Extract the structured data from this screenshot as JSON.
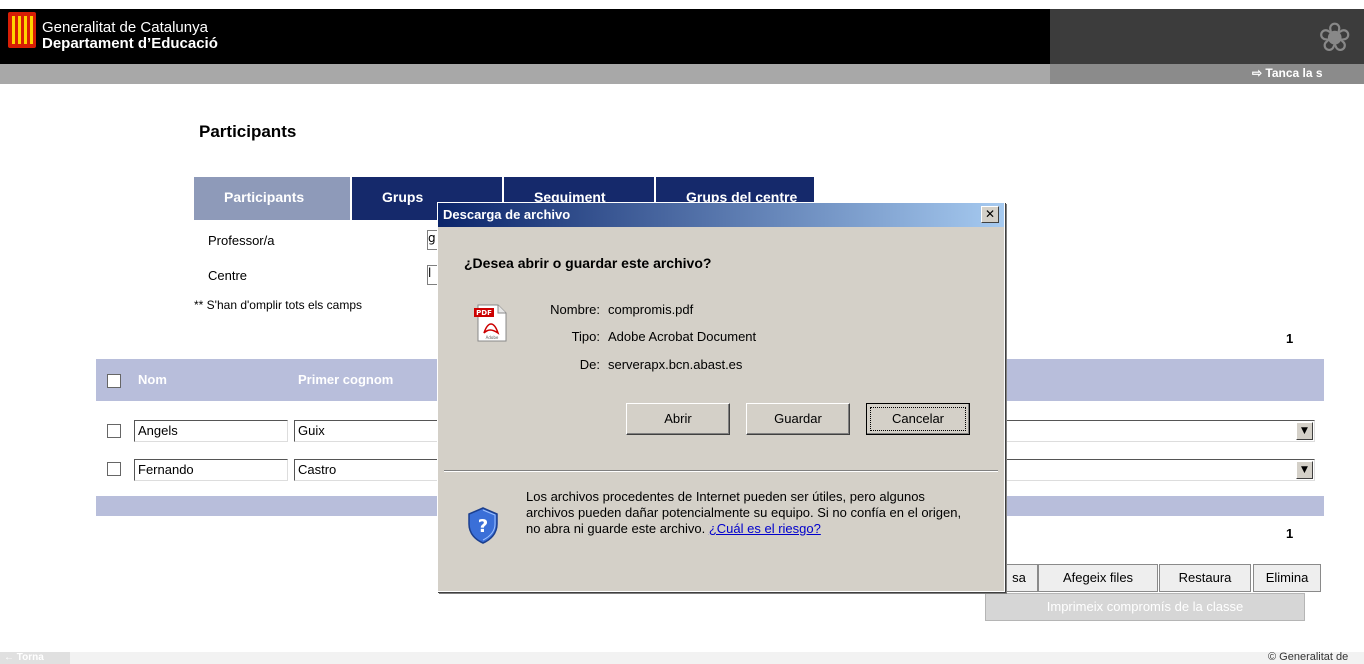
{
  "header": {
    "line1": "Generalitat de Catalunya",
    "line2": "Departament d’Educació",
    "close_session": "⇨ Tanca la s"
  },
  "page": {
    "title": "Participants"
  },
  "tabs": [
    {
      "label": "Participants",
      "active": true
    },
    {
      "label": "Grups",
      "active": false
    },
    {
      "label": "Seguiment",
      "active": false
    },
    {
      "label": "Grups del centre",
      "active": false
    }
  ],
  "form": {
    "professor_label": "Professor/a",
    "professor_value": "g",
    "centre_label": "Centre",
    "centre_value": "l",
    "required_note": "** S'han d'omplir tots els camps"
  },
  "pagination": {
    "top": "1",
    "bottom": "1"
  },
  "table": {
    "headers": [
      "Nom",
      "Primer cognom"
    ],
    "rows": [
      {
        "nom": "Angels",
        "cognom": "Guix"
      },
      {
        "nom": "Fernando",
        "cognom": "Castro"
      }
    ]
  },
  "buttons": {
    "partial": "sa",
    "afegeix": "Afegeix files",
    "restaura": "Restaura",
    "elimina": "Elimina",
    "imprimeix": "Imprimeix compromís de la classe"
  },
  "footer": {
    "back": "← Torna",
    "copyright": "© Generalitat de"
  },
  "dialog": {
    "title": "Descarga de archivo",
    "question": "¿Desea abrir o guardar este archivo?",
    "name_label": "Nombre:",
    "name_value": "compromis.pdf",
    "type_label": "Tipo:",
    "type_value": "Adobe Acrobat Document",
    "from_label": "De:",
    "from_value": "serverapx.bcn.abast.es",
    "open": "Abrir",
    "save": "Guardar",
    "cancel": "Cancelar",
    "warning": "Los archivos procedentes de Internet pueden ser útiles, pero algunos archivos pueden dañar potencialmente su equipo. Si no confía en el origen, no abra ni guarde este archivo. ",
    "risk_link": "¿Cuál es el riesgo?",
    "pdf_badge": "PDF",
    "pdf_brand": "Adobe"
  },
  "colors": {
    "tab_active": "#8e9ab9",
    "tab_inactive": "#15296b",
    "table_header": "#b8bedb",
    "dialog_bg": "#d4d0c8"
  }
}
